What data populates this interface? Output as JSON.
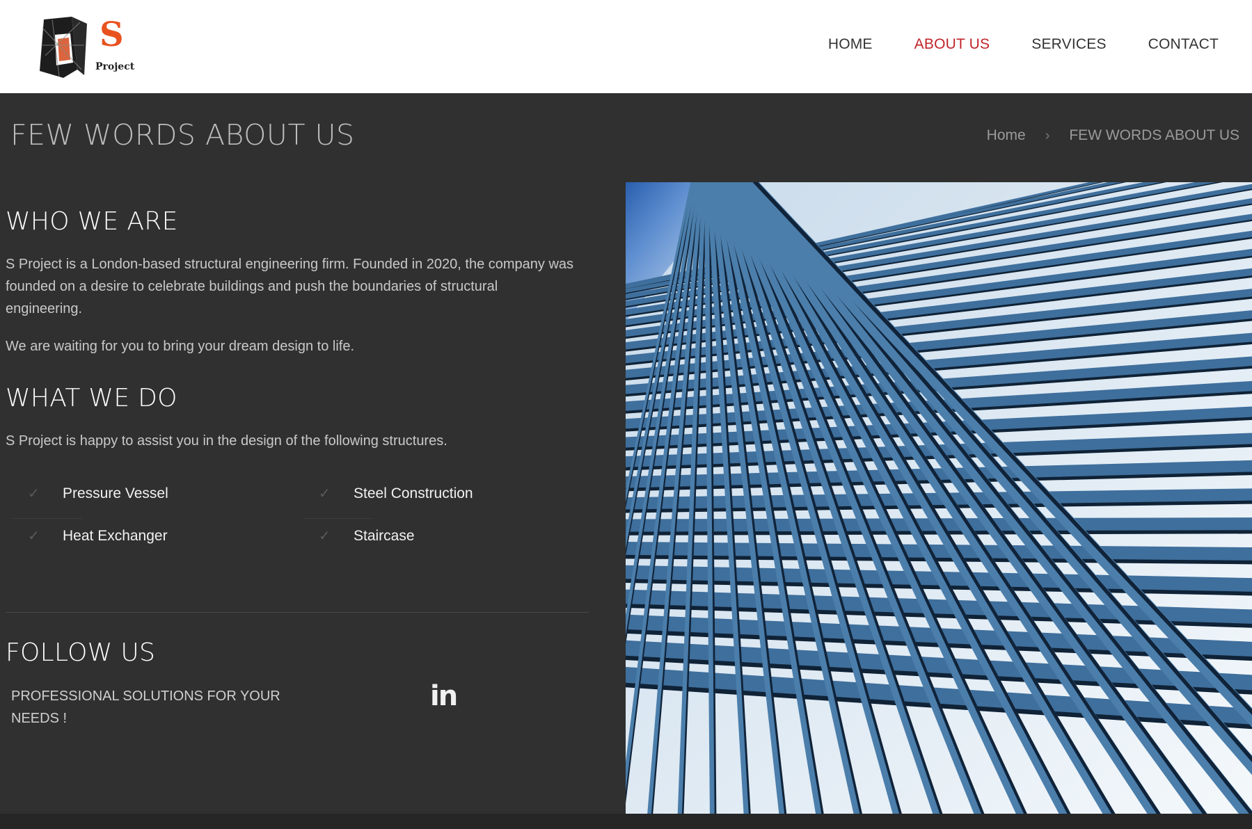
{
  "nav": {
    "items": [
      {
        "label": "HOME"
      },
      {
        "label": "ABOUT US"
      },
      {
        "label": "SERVICES"
      },
      {
        "label": "CONTACT"
      }
    ],
    "active": "ABOUT US",
    "active_color": "#c0242a"
  },
  "logo": {
    "text_s": "S",
    "text_project": "Project"
  },
  "title_bar": {
    "title": "FEW WORDS ABOUT US",
    "breadcrumb": [
      "Home",
      "FEW WORDS ABOUT US"
    ],
    "separator_icon": "chevron-right-icon"
  },
  "who_we_are": {
    "heading": "WHO WE ARE",
    "paragraph1": "S Project is a London-based structural engineering firm. Founded in 2020, the company was founded on a desire to celebrate buildings and push the boundaries of structural engineering.",
    "paragraph2": "We are waiting for you to bring your dream design to life."
  },
  "what_we_do": {
    "heading": "WHAT WE DO",
    "paragraph": "S Project is happy to assist you in the design of the following structures.",
    "services": [
      "Pressure Vessel",
      "Steel Construction",
      "Heat Exchanger",
      "Staircase"
    ],
    "service_icon": "check-icon"
  },
  "follow_us": {
    "heading": "FOLLOW US",
    "tagline": "PROFESSIONAL SOLUTIONS FOR YOUR NEEDS !",
    "social_icon": "linkedin-icon",
    "social_label": "in"
  },
  "colors": {
    "background": "#303030",
    "header": "#ffffff",
    "accent": "#c0242a"
  }
}
